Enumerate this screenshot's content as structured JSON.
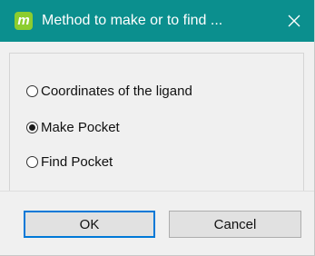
{
  "window": {
    "title": "Method to make or to find ...",
    "app_icon_letter": "m",
    "close_icon": "close-icon"
  },
  "options": [
    {
      "label": "Coordinates of the ligand",
      "checked": false
    },
    {
      "label": "Make Pocket",
      "checked": true
    },
    {
      "label": "Find Pocket",
      "checked": false
    }
  ],
  "buttons": {
    "ok_label": "OK",
    "cancel_label": "Cancel"
  },
  "colors": {
    "titlebar": "#0b8f8e",
    "app_icon": "#8ccd2f",
    "default_button_border": "#0078d7"
  }
}
